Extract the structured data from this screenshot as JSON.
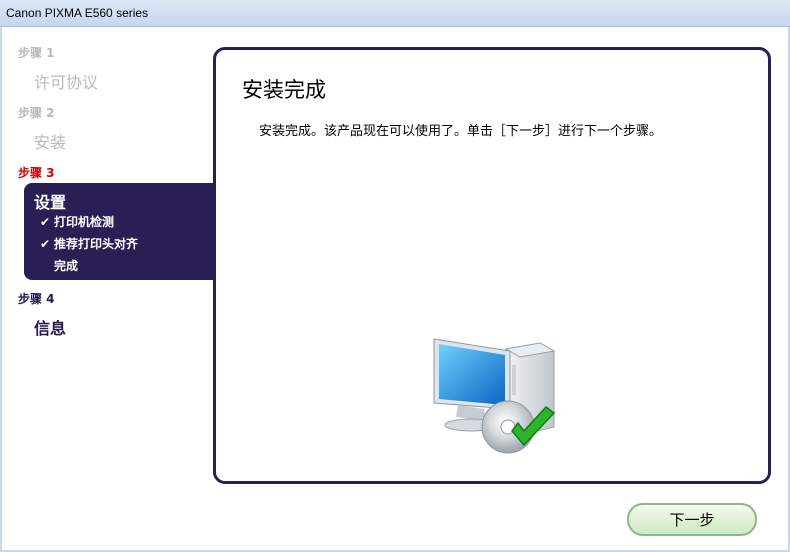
{
  "window": {
    "title": "Canon PIXMA E560 series"
  },
  "sidebar": {
    "steps": [
      {
        "label": "步骤 1",
        "name": "许可协议"
      },
      {
        "label": "步骤 2",
        "name": "安装"
      },
      {
        "label": "步骤 3",
        "name": "设置",
        "subitems": [
          {
            "text": "打印机检测",
            "checked": true
          },
          {
            "text": "推荐打印头对齐",
            "checked": true
          },
          {
            "text": "完成",
            "checked": false
          }
        ]
      },
      {
        "label": "步骤 4",
        "name": "信息"
      }
    ],
    "check_glyph": "✔"
  },
  "main": {
    "title": "安装完成",
    "message": "安装完成。该产品现在可以使用了。单击［下一步］进行下一个步骤。",
    "illustration": "computer-cd-check-icon"
  },
  "footer": {
    "next_label": "下一步"
  },
  "colors": {
    "accent": "#2a1f55",
    "current_step": "#d40000",
    "done_step": "#b9b9b9",
    "button_border": "#8fb68a"
  }
}
